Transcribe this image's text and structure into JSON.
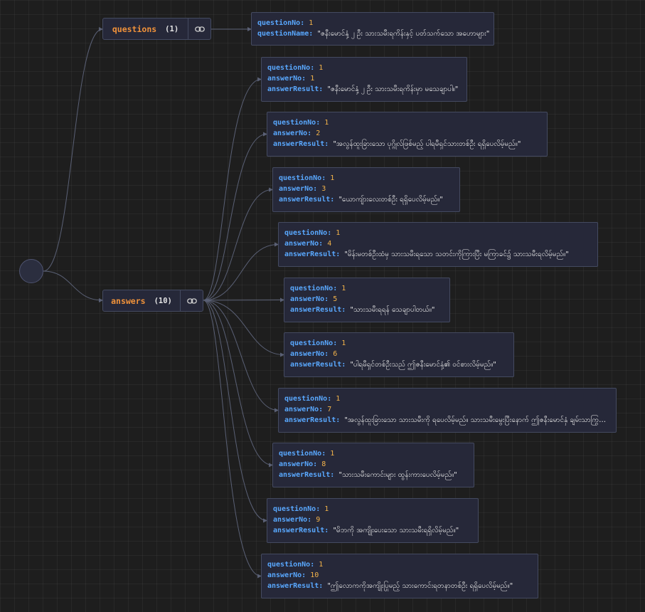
{
  "root": {
    "name": "root"
  },
  "groups": {
    "questions": {
      "label": "questions",
      "count": "(1)",
      "icon": "link-icon"
    },
    "answers": {
      "label": "answers",
      "count": "(10)",
      "icon": "link-icon"
    }
  },
  "keys": {
    "questionNo": "questionNo:",
    "questionName": "questionName:",
    "answerNo": "answerNo:",
    "answerResult": "answerResult:"
  },
  "questions": [
    {
      "questionNo": "1",
      "questionName": "\"ဇနီးမောင်နှံ့ ၂ ဦး သားသမီးရကိန်းနှင့် ပတ်သက်သော အဟောများ\""
    }
  ],
  "answers": [
    {
      "questionNo": "1",
      "answerNo": "1",
      "answerResult": "\"ဇနီးမောင်နှံ့ ၂ ဦး သားသမီးရကိန်းမှာ မသေချာပါ။\""
    },
    {
      "questionNo": "1",
      "answerNo": "2",
      "answerResult": "\"အလွန်ထူးခြားသော ပုဂ္ဂိုလ်ဖြစ်မည့် ပါရမီရှင်သားတစ်ဦး ရရှိပေလိမ့်မည်။\""
    },
    {
      "questionNo": "1",
      "answerNo": "3",
      "answerResult": "\"ယောကျ်ားလေးတစ်ဦး ရရှိပေလိမ့်မည်။\""
    },
    {
      "questionNo": "1",
      "answerNo": "4",
      "answerResult": "\"မိန်းမတစ်ဦးထံမှ သားသမီးရသော သတင်းကိုကြားပြီး မကြာခင်၌ သားသမီးရလိမ့်မည်။\""
    },
    {
      "questionNo": "1",
      "answerNo": "5",
      "answerResult": "\"သားသမီးရရန် သေချာပါတယ်။\""
    },
    {
      "questionNo": "1",
      "answerNo": "6",
      "answerResult": "\"ပါရမီရှင်တစ်ဦးသည် ဤဇနီးမောင်နှံ့၏ ဝင်စားလိမ့်မည်။\""
    },
    {
      "questionNo": "1",
      "answerNo": "7",
      "answerResult": "\"အလွန်ထူးခြားသော သားသမီးကို ရပေလိမ့်မည်။ သားသမီးမွေးပြီးနောက် ဤဇနီးမောင်နှံ ချမ်းသာကြွယ်ဝလိမ့်မည်။\""
    },
    {
      "questionNo": "1",
      "answerNo": "8",
      "answerResult": "\"သားသမီးကောင်းများ ထွန်းကားပေလိမ့်မည်။\""
    },
    {
      "questionNo": "1",
      "answerNo": "9",
      "answerResult": "\"မိဘကို အကျိုးပေးသော သားသမီးရရှိလိမ့်မည်။\""
    },
    {
      "questionNo": "1",
      "answerNo": "10",
      "answerResult": "\"ဤလောကကိုအကျိုးပြုမည့် သားကောင်းရတနာတစ်ဦး ရရှိပေလိမ့်မည်။\""
    }
  ]
}
